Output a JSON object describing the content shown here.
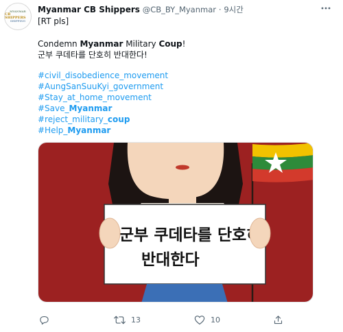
{
  "tweet": {
    "avatar_text": [
      "MYANMAR",
      "CB SHIPPERS",
      "SHIPPING"
    ],
    "author_name": "Myanmar CB Shippers",
    "author_handle": "@CB_BY_Myanmar",
    "separator": "·",
    "timestamp": "9시간",
    "rt_request": "[RT pls]",
    "body_en_1": "Condemn ",
    "body_en_2": "Myanmar",
    "body_en_3": " Military ",
    "body_en_4": "Coup",
    "body_en_5": "!",
    "body_ko": "군부 쿠데타를 단호히 반대한다!",
    "hashtags": [
      {
        "text": "#civil_disobedience_movement",
        "bold": ""
      },
      {
        "text": "#AungSanSuuKyi_government",
        "bold": ""
      },
      {
        "text": "#Stay_at_home_movement",
        "bold": ""
      },
      {
        "text": "#Save_",
        "bold": "Myanmar"
      },
      {
        "text": "#reject_military_",
        "bold": "coup"
      },
      {
        "text": "#Help_",
        "bold": "Myanmar"
      }
    ],
    "image_sign_line1": "군부 쿠데타를 단호히",
    "image_sign_line2": "반대한다",
    "retweet_count": "13",
    "like_count": "10"
  },
  "icons": {
    "more": "more-horizontal-icon",
    "reply": "reply-icon",
    "retweet": "retweet-icon",
    "like": "heart-icon",
    "share": "share-icon"
  },
  "colors": {
    "link": "#1d9bf0",
    "secondary_text": "#536471",
    "image_background": "#9c2121"
  }
}
